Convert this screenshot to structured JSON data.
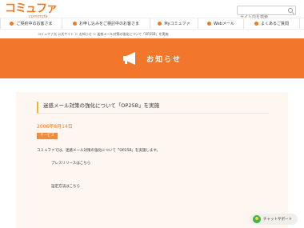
{
  "logo": {
    "main": "コミュファ",
    "sub": "commufa"
  },
  "search": {
    "placeholder": "サイト内を検索"
  },
  "nav": [
    {
      "label": "ご契約中のお客さま"
    },
    {
      "label": "お申し込みをご検討中のお客さま"
    },
    {
      "label": "Myコミュファ"
    },
    {
      "label": "Webメール"
    },
    {
      "label": "よくあるご質問"
    }
  ],
  "breadcrumb": "コミュファ光 公式サイト ＞ お知らせ ＞ 迷惑メール対策の強化について「OP25B」を実施",
  "hero": {
    "title": "お知らせ"
  },
  "article": {
    "title": "迷惑メール対策の強化について「OP25B」を実施",
    "date": "2006年8月14日",
    "tag": "サービス",
    "body": "コミュファでは、迷惑メール対策の強化について「OP25B」を実施します。",
    "link1": "プレスリリースはこちら",
    "link2": "設定方法はこちら"
  },
  "chat": {
    "label": "チャットサポート"
  },
  "colors": {
    "accent": "#f3772a",
    "background": "#fdf6f1"
  }
}
